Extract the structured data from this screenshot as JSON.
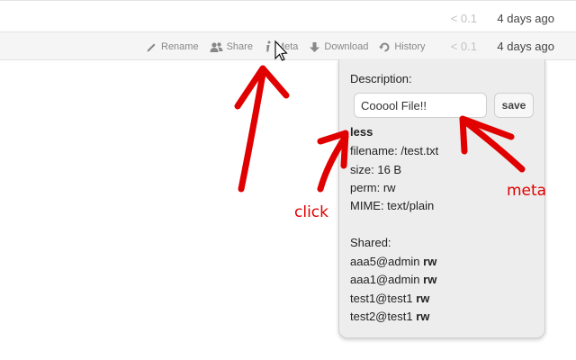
{
  "rows": [
    {
      "size": "< 0.1",
      "date": "4 days ago"
    },
    {
      "size": "< 0.1",
      "date": "4 days ago"
    }
  ],
  "actions": [
    {
      "label": "Rename",
      "icon": "pencil-icon"
    },
    {
      "label": "Share",
      "icon": "users-icon"
    },
    {
      "label": "Meta",
      "icon": "info-icon"
    },
    {
      "label": "Download",
      "icon": "download-icon"
    },
    {
      "label": "History",
      "icon": "history-icon"
    }
  ],
  "meta_panel": {
    "description_label": "Description:",
    "description_value": "Cooool File!!",
    "save_label": "save",
    "less_label": "less",
    "filename": "filename: /test.txt",
    "size": "size: 16 B",
    "perm": "perm: rw",
    "mime": "MIME: text/plain",
    "shared_label": "Shared:",
    "shared": [
      {
        "user": "aaa5@admin",
        "perm": "rw"
      },
      {
        "user": "aaa1@admin",
        "perm": "rw"
      },
      {
        "user": "test1@test1",
        "perm": "rw"
      },
      {
        "user": "test2@test1",
        "perm": "rw"
      }
    ]
  },
  "annotations": {
    "click": "click",
    "meta": "meta",
    "color": "#e00000"
  }
}
